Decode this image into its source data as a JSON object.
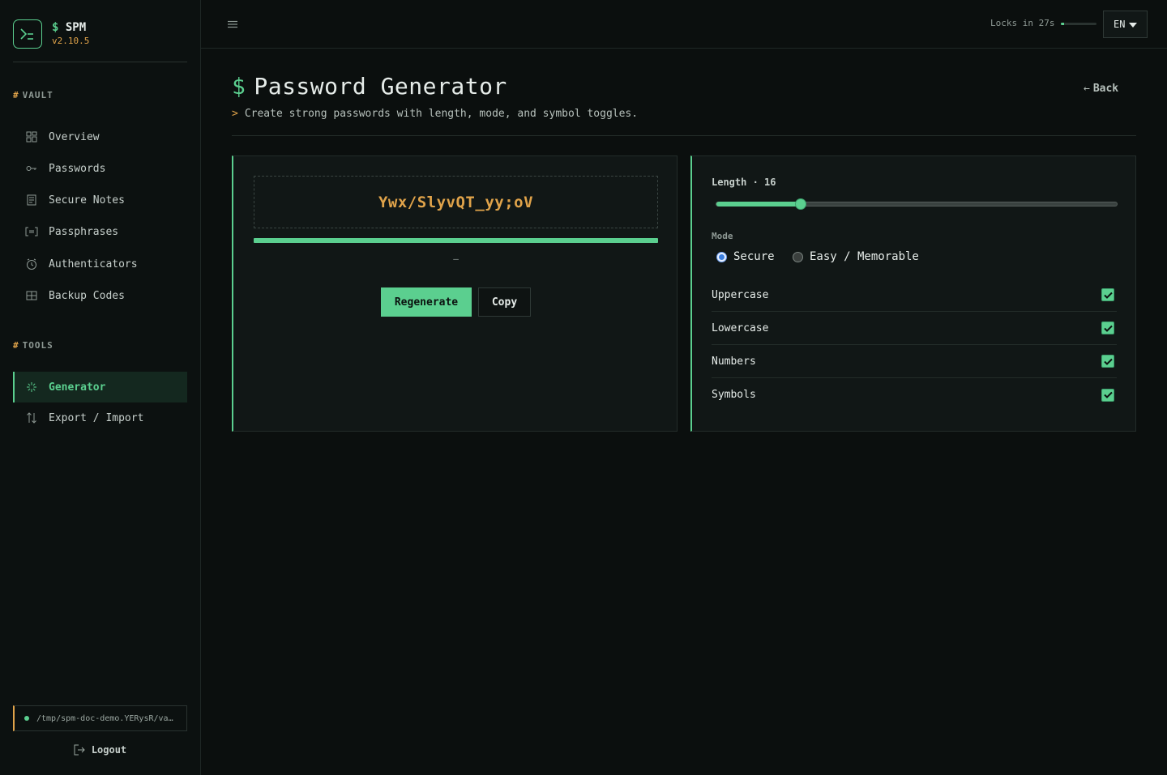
{
  "brand": {
    "prompt": "$",
    "name": "SPM",
    "version": "v2.10.5"
  },
  "sidebar": {
    "vault_section": {
      "hash": "#",
      "title": "VAULT"
    },
    "vault_items": [
      {
        "label": "Overview",
        "icon": "grid-icon"
      },
      {
        "label": "Passwords",
        "icon": "key-icon"
      },
      {
        "label": "Secure Notes",
        "icon": "note-icon"
      },
      {
        "label": "Passphrases",
        "icon": "bracket-icon"
      },
      {
        "label": "Authenticators",
        "icon": "clock-icon"
      },
      {
        "label": "Backup Codes",
        "icon": "table-icon"
      }
    ],
    "tools_section": {
      "hash": "#",
      "title": "TOOLS"
    },
    "tool_items": [
      {
        "label": "Generator",
        "icon": "sparkle-icon",
        "active": true
      },
      {
        "label": "Export / Import",
        "icon": "swap-arrows-icon",
        "active": false
      }
    ],
    "vault_path": "/tmp/spm-doc-demo.YERysR/vault.db",
    "logout_label": "Logout"
  },
  "topbar": {
    "lock_text": "Locks in 27s",
    "lock_fraction": 0.1,
    "language": "EN"
  },
  "page": {
    "prompt": "$",
    "title": "Password Generator",
    "subtitle_prompt": ">",
    "subtitle": "Create strong passwords with length, mode, and symbol toggles.",
    "back_arrow": "←",
    "back_label": "Back"
  },
  "generator": {
    "password": "Ywx/SlyvQT_yy;oV",
    "strength_fraction": 1.0,
    "strength_label": "–",
    "regenerate_label": "Regenerate",
    "copy_label": "Copy"
  },
  "options": {
    "length_label": "Length · 16",
    "length": 16,
    "length_fraction": 0.21,
    "mode_label": "Mode",
    "modes": [
      {
        "label": "Secure",
        "checked": true
      },
      {
        "label": "Easy / Memorable",
        "checked": false
      }
    ],
    "toggles": [
      {
        "label": "Uppercase",
        "checked": true
      },
      {
        "label": "Lowercase",
        "checked": true
      },
      {
        "label": "Numbers",
        "checked": true
      },
      {
        "label": "Symbols",
        "checked": true
      }
    ]
  },
  "colors": {
    "accent": "#5bcf8f",
    "highlight": "#e0a34a",
    "background": "#0b0f0e"
  }
}
